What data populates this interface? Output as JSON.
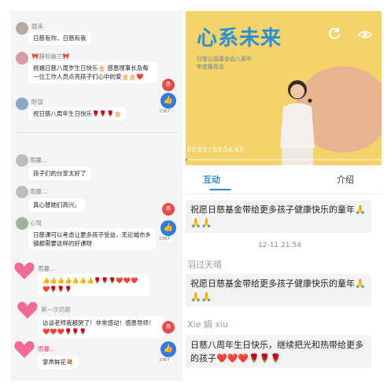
{
  "left_chat": {
    "messages": [
      {
        "name": "靓来",
        "text": "日慈有你，日慈有我"
      },
      {
        "name": "🎀静如幽兰🎀",
        "text": "祝福日慈八周岁生日快乐🎂 感恩理事长及每一位工作人员点亮孩子们心中的爱🎂🎂❤️"
      },
      {
        "name": "盼望",
        "text": "祝日慈八周年生日快乐🌹🌹🌹🎂"
      },
      {
        "name": "雨蔓...",
        "text": "孩子们的分享太好了"
      },
      {
        "name": "雨蔓...",
        "text": "真心替她们高兴。"
      },
      {
        "name": "心弩",
        "text": "日慈课可以考虑让更多孩子受益，无论城市乡镇都需要这样的好课呀"
      },
      {
        "name": "雨蔓...",
        "text": "👍👍👍👍👍👍👍🌹🌹🌹❤️❤️❤️❤️🌹🌹🌹"
      },
      {
        "name": "第一次见面",
        "text": "访谈老师我都哭了！非常感动！感恩导师！❤️❤️❤️🌹🌹🌹"
      },
      {
        "name": "雨蔓...",
        "text": "掌声鲜花💐"
      }
    ],
    "like_counts": [
      "2367",
      "2367",
      "2367"
    ],
    "gift_badge": "惠"
  },
  "video": {
    "title": "心系未来",
    "subtitle_lines": [
      "日慈公益基金会八周年",
      "年度报告会"
    ],
    "time_text": "00:03 / 03:54:43",
    "progress_fraction": 0.0001,
    "accent": "#2a8fd6"
  },
  "tabs": {
    "active": "互动",
    "inactive": "介绍"
  },
  "comments": [
    {
      "user": "",
      "text": "祝愿日慈基金带给更多孩子健康快乐的童年🙏🙏🙏",
      "time": "12-11 21:54"
    },
    {
      "user": "羽过天晴",
      "text": "祝愿日慈基金带给更多孩子健康快乐的童年🙏🙏🙏",
      "time": ""
    },
    {
      "user": "Xie 娟 xiu",
      "text": "日慈八周年生日快乐，继续把光和热带给更多的孩子❤️❤️❤️🌹🌹🌹",
      "time": ""
    }
  ]
}
